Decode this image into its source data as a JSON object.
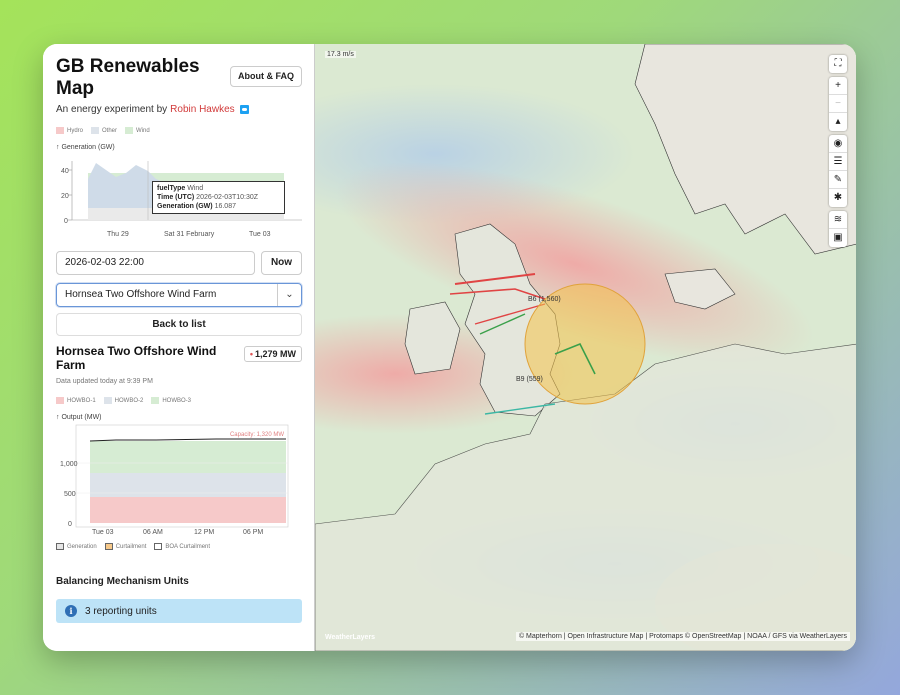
{
  "app": {
    "title": "GB Renewables Map",
    "about_label": "About & FAQ",
    "subtitle_prefix": "An energy experiment by",
    "author": "Robin Hawkes"
  },
  "generation_chart": {
    "legend": [
      {
        "label": "Hydro",
        "color": "#f6c9c9"
      },
      {
        "label": "Other",
        "color": "#dde3ea"
      },
      {
        "label": "Wind",
        "color": "#d6ecd3"
      }
    ],
    "axis_title": "↑ Generation (GW)",
    "y_ticks": [
      "40",
      "20",
      "0"
    ],
    "x_ticks": [
      "Thu 29",
      "Sat 31 February",
      "Tue 03"
    ],
    "tooltip": {
      "fueltype_key": "fuelType",
      "fueltype_val": "Wind",
      "time_key": "Time (UTC)",
      "time_val": "2026-02-03T10:30Z",
      "gen_key": "Generation (GW)",
      "gen_val": "16.087"
    }
  },
  "datetime": {
    "value": "2026-02-03 22:00",
    "now_label": "Now"
  },
  "site_select": {
    "value": "Hornsea Two Offshore Wind Farm",
    "chevron": "⌄"
  },
  "back_label": "Back to list",
  "site": {
    "name": "Hornsea Two Offshore Wind Farm",
    "capacity_badge": "1,279 MW",
    "updated": "Data updated today at 9:39 PM",
    "legend": [
      {
        "label": "HOWBO-1",
        "color": "#f6c9c9"
      },
      {
        "label": "HOWBO-2",
        "color": "#dde3ea"
      },
      {
        "label": "HOWBO-3",
        "color": "#d6ecd3"
      }
    ],
    "axis_title": "↑ Output (MW)",
    "capacity_label": "Capacity: 1,320 MW",
    "y_ticks": [
      "1,000",
      "500",
      "0"
    ],
    "x_ticks": [
      "Tue 03",
      "06 AM",
      "12 PM",
      "06 PM"
    ],
    "bottom_legend": [
      {
        "label": "Generation",
        "color": "#e6e6e6"
      },
      {
        "label": "Curtailment",
        "color": "#f7c98a"
      },
      {
        "label": "BOA Curtailment",
        "color": "#ffffff"
      }
    ]
  },
  "bm_units": {
    "title": "Balancing Mechanism Units",
    "reporting": "3 reporting units",
    "info_icon": "info-icon"
  },
  "map": {
    "wind_speed": "17.3 m/s",
    "labels": {
      "b6": "B6 (1,560)",
      "b9": "B9 (559)"
    },
    "attribution": "© Mapterhorn | Open Infrastructure Map | Protomaps © OpenStreetMap | NOAA / GFS via WeatherLayers",
    "logo": "WeatherLayers",
    "controls": [
      "fullscreen-icon",
      "zoom-in-icon",
      "zoom-out-icon",
      "compass-icon",
      "locate-icon",
      "layers-icon",
      "brush-icon",
      "fire-icon",
      "wind-icon",
      "car-icon"
    ]
  }
}
